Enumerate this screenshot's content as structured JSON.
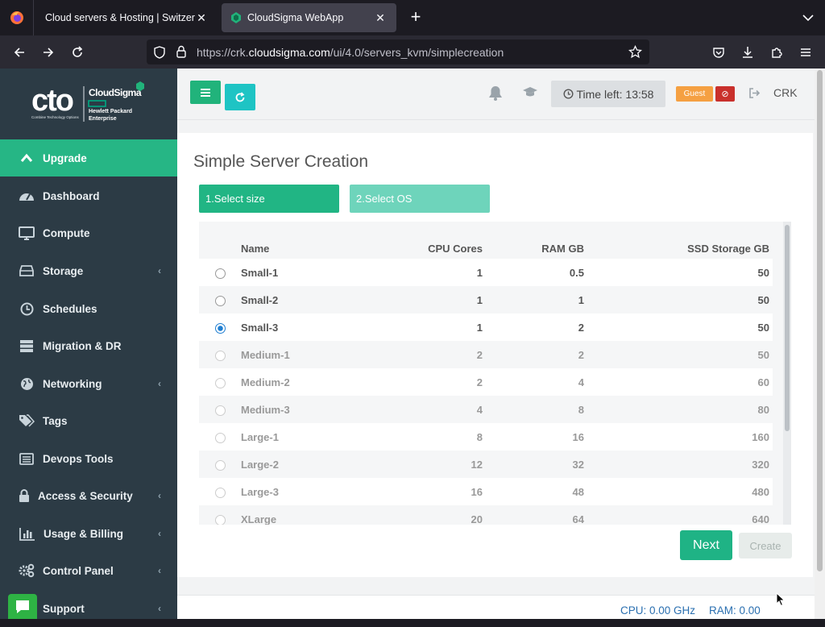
{
  "browser": {
    "tabs": [
      {
        "label": "Cloud servers & Hosting | Switzerlar",
        "active": false
      },
      {
        "label": "CloudSigma WebApp",
        "active": true
      }
    ],
    "url_prefix": "https://crk.",
    "url_host": "cloudsigma.com",
    "url_path": "/ui/4.0/servers_kvm/simplecreation"
  },
  "logo": {
    "left": "cto",
    "left_sub": "Combine Technology Options",
    "brand": "CloudSigma",
    "partner": "Hewlett Packard Enterprise"
  },
  "sidebar": {
    "items": [
      {
        "label": "Upgrade",
        "icon": "chevron-up-icon",
        "active": true,
        "submenu": false
      },
      {
        "label": "Dashboard",
        "icon": "dashboard-gauge-icon",
        "active": false,
        "submenu": false
      },
      {
        "label": "Compute",
        "icon": "monitor-icon",
        "active": false,
        "submenu": false
      },
      {
        "label": "Storage",
        "icon": "hard-drive-icon",
        "active": false,
        "submenu": true
      },
      {
        "label": "Schedules",
        "icon": "clock-icon",
        "active": false,
        "submenu": false
      },
      {
        "label": "Migration & DR",
        "icon": "server-rack-icon",
        "active": false,
        "submenu": false
      },
      {
        "label": "Networking",
        "icon": "globe-icon",
        "active": false,
        "submenu": true
      },
      {
        "label": "Tags",
        "icon": "tags-icon",
        "active": false,
        "submenu": false
      },
      {
        "label": "Devops Tools",
        "icon": "list-icon",
        "active": false,
        "submenu": false
      },
      {
        "label": "Access & Security",
        "icon": "lock-icon",
        "active": false,
        "submenu": true
      },
      {
        "label": "Usage & Billing",
        "icon": "bar-chart-icon",
        "active": false,
        "submenu": true
      },
      {
        "label": "Control Panel",
        "icon": "cogs-icon",
        "active": false,
        "submenu": true
      },
      {
        "label": "Support",
        "icon": "chat-icon",
        "active": false,
        "submenu": true
      }
    ]
  },
  "header": {
    "time_left": "Time left: 13:58",
    "guest_badge": "Guest",
    "user": "CRK"
  },
  "page": {
    "title": "Simple Server Creation",
    "steps": [
      "1.Select size",
      "2.Select OS"
    ]
  },
  "table": {
    "columns": [
      "Name",
      "CPU Cores",
      "RAM GB",
      "SSD Storage GB"
    ],
    "rows": [
      {
        "name": "Small-1",
        "cpu": "1",
        "ram": "0.5",
        "ssd": "50",
        "selected": false,
        "enabled": true
      },
      {
        "name": "Small-2",
        "cpu": "1",
        "ram": "1",
        "ssd": "50",
        "selected": false,
        "enabled": true
      },
      {
        "name": "Small-3",
        "cpu": "1",
        "ram": "2",
        "ssd": "50",
        "selected": true,
        "enabled": true
      },
      {
        "name": "Medium-1",
        "cpu": "2",
        "ram": "2",
        "ssd": "50",
        "selected": false,
        "enabled": false
      },
      {
        "name": "Medium-2",
        "cpu": "2",
        "ram": "4",
        "ssd": "60",
        "selected": false,
        "enabled": false
      },
      {
        "name": "Medium-3",
        "cpu": "4",
        "ram": "8",
        "ssd": "80",
        "selected": false,
        "enabled": false
      },
      {
        "name": "Large-1",
        "cpu": "8",
        "ram": "16",
        "ssd": "160",
        "selected": false,
        "enabled": false
      },
      {
        "name": "Large-2",
        "cpu": "12",
        "ram": "32",
        "ssd": "320",
        "selected": false,
        "enabled": false
      },
      {
        "name": "Large-3",
        "cpu": "16",
        "ram": "48",
        "ssd": "480",
        "selected": false,
        "enabled": false
      },
      {
        "name": "XLarge",
        "cpu": "20",
        "ram": "64",
        "ssd": "640",
        "selected": false,
        "enabled": false
      }
    ]
  },
  "actions": {
    "next": "Next",
    "create": "Create"
  },
  "footer": {
    "cpu": "CPU: 0.00 GHz",
    "ram": "RAM: 0.00"
  },
  "colors": {
    "accent_green": "#26b685",
    "teal": "#1ec4c4",
    "sidebar_bg": "#2c3b45",
    "guest_orange": "#f5a042",
    "danger_red": "#c9302c",
    "link_blue": "#2a6fb0"
  }
}
